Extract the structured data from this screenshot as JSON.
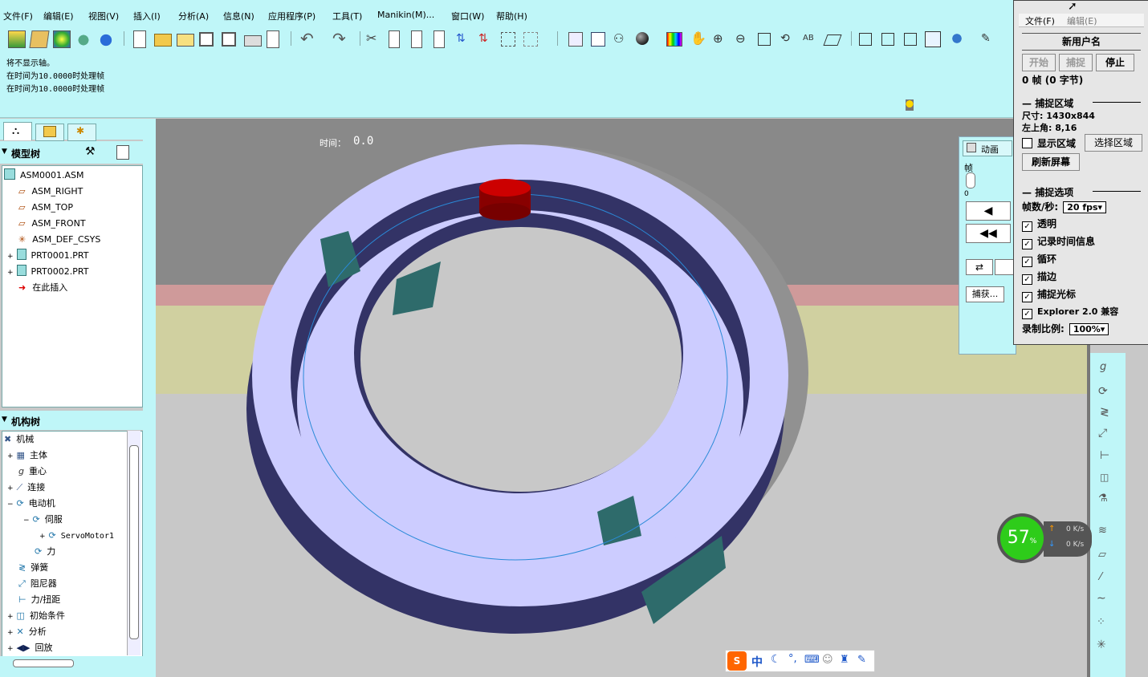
{
  "menu": [
    "文件(F)",
    "编辑(E)",
    "视图(V)",
    "插入(I)",
    "分析(A)",
    "信息(N)",
    "应用程序(P)",
    "工具(T)",
    "Manikin(M)...",
    "窗口(W)",
    "帮助(H)"
  ],
  "messages": [
    "将不显示轴。",
    "在时间为10.0000时处理帧",
    "在时间为10.0000时处理帧"
  ],
  "model_tree": {
    "title": "模型树",
    "items": [
      "ASM0001.ASM",
      "ASM_RIGHT",
      "ASM_TOP",
      "ASM_FRONT",
      "ASM_DEF_CSYS",
      "PRT0001.PRT",
      "PRT0002.PRT",
      "在此插入"
    ]
  },
  "mech_tree": {
    "title": "机构树",
    "items": [
      "机械",
      "主体",
      "重心",
      "连接",
      "电动机",
      "伺服",
      "ServoMotor1",
      "力",
      "弹簧",
      "阻尼器",
      "力/扭距",
      "初始条件",
      "分析",
      "回放"
    ]
  },
  "viewport": {
    "time_label": "时间：",
    "time_value": "0.0"
  },
  "anim_panel": {
    "title": "动画",
    "frame_label": "帧",
    "frame_value": "0",
    "capture_button": "捕获..."
  },
  "capture_window": {
    "menu_file": "文件(F)",
    "menu_edit": "编辑(E)",
    "user": "新用户名",
    "btn_start": "开始",
    "btn_capture": "捕捉",
    "btn_stop": "停止",
    "frames": "0 帧 (0 字节)",
    "area_section": "捕捉区域",
    "size": "尺寸:  1430x844",
    "topleft": "左上角:  8,16",
    "show_area": "显示区域",
    "select_area": "选择区域",
    "refresh": "刷新屏幕",
    "options_section": "捕捉选项",
    "fps_label": "帧数/秒:",
    "fps_value": "20 fps",
    "opt_transparent": "透明",
    "opt_time": "记录时间信息",
    "opt_loop": "循环",
    "opt_border": "描边",
    "opt_cursor": "捕捉光标",
    "opt_explorer": "Explorer 2.0 兼容",
    "scale_label": "录制比例:",
    "scale_value": "100%"
  },
  "speed_gauge": {
    "percent": "57",
    "pct_sign": "%",
    "up": "0 K/s",
    "down": "0 K/s"
  },
  "ime": {
    "label": "中"
  },
  "colors": {
    "panel": "#bff6f8",
    "ring_top": "#ccccff",
    "ring_side": "#333366",
    "accent": "#c00000"
  }
}
